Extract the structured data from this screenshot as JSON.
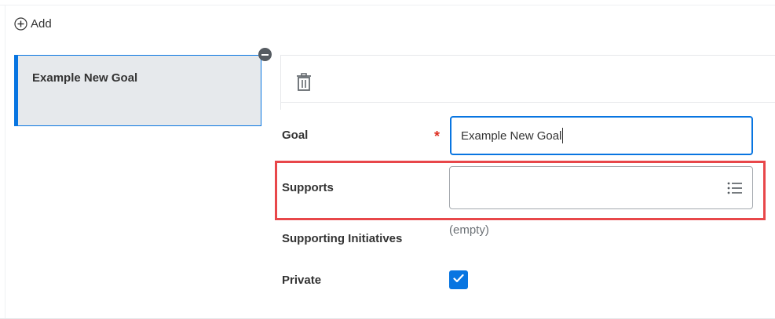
{
  "toolbar": {
    "add_label": "Add"
  },
  "goal_card": {
    "title": "Example New Goal"
  },
  "form": {
    "goal": {
      "label": "Goal",
      "required_marker": "*",
      "value": "Example New Goal"
    },
    "supports": {
      "label": "Supports",
      "value": ""
    },
    "supporting_initiatives": {
      "label": "Supporting Initiatives",
      "value": "(empty)"
    },
    "private": {
      "label": "Private",
      "checked": true
    }
  },
  "icons": {
    "add": "plus-circle-icon",
    "remove": "minus-circle-icon",
    "delete": "trash-icon",
    "prompt": "list-icon",
    "check": "checkmark-icon"
  },
  "colors": {
    "accent": "#0875e1",
    "highlight": "#e8474a",
    "required": "#de2e21",
    "card_background": "#e6e9ec"
  }
}
